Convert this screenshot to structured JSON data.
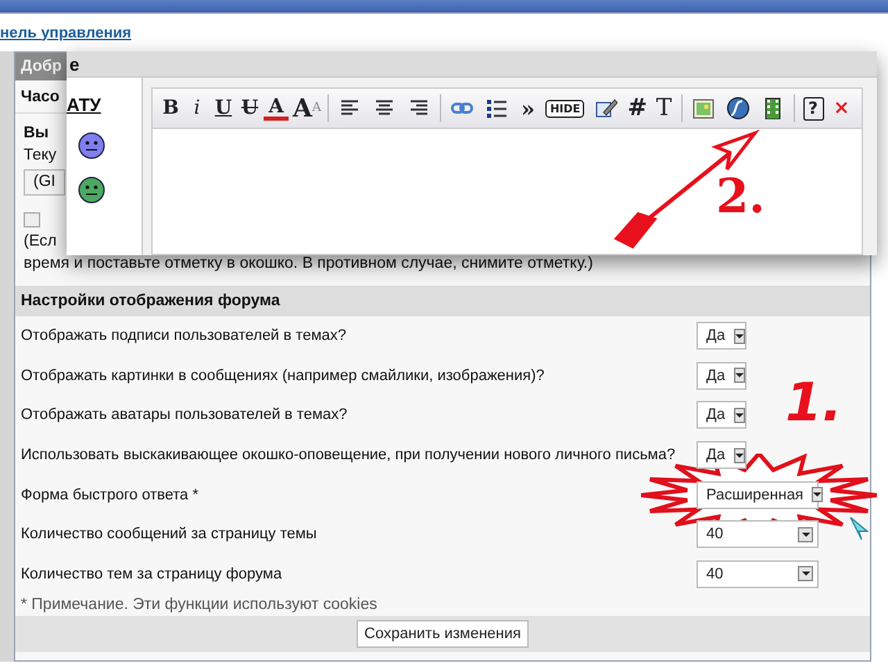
{
  "nav_link": "нель управления",
  "panel": {
    "title": "Добр",
    "subheader": "Часо",
    "heading": "Вы",
    "label": "Теку",
    "select_value": "(GI",
    "checkbox": {
      "checked": false
    },
    "text_1": "(Есл",
    "text_2": "время и поставьте отметку в окошко. В противном случае, снимите отметку.)"
  },
  "display_settings": {
    "heading": "Настройки отображения форума",
    "rows": [
      {
        "label": "Отображать подписи пользователей в темах?",
        "value": "Да",
        "kind": "short",
        "highlighted": false
      },
      {
        "label": "Отображать картинки в сообщениях (например смайлики, изображения)?",
        "value": "Да",
        "kind": "short",
        "highlighted": false
      },
      {
        "label": "Отображать аватары пользователей в темах?",
        "value": "Да",
        "kind": "short",
        "highlighted": false
      },
      {
        "label": "Использовать выскакивающее окошко-оповещение, при получении нового личного письма?",
        "value": "Да",
        "kind": "short",
        "highlighted": false
      },
      {
        "label": "Форма быстрого ответа *",
        "value": "Расширенная",
        "kind": "long",
        "highlighted": true
      },
      {
        "label": "Количество сообщений за страницу темы",
        "value": "40",
        "kind": "long",
        "highlighted": false
      },
      {
        "label": "Количество тем за страницу форума",
        "value": "40",
        "kind": "long",
        "highlighted": false
      }
    ],
    "footnote": "* Примечание. Эти функции используют cookies",
    "save_button": "Сохранить изменения"
  },
  "popup": {
    "title": "е",
    "sidebar_heading": "АТУ",
    "annotation": "2.",
    "toolbar": [
      {
        "kind": "bold",
        "label": "B"
      },
      {
        "kind": "italic",
        "label": "i"
      },
      {
        "kind": "underline",
        "label": "U"
      },
      {
        "kind": "strike",
        "label": "U"
      },
      {
        "kind": "color",
        "label": "A"
      },
      {
        "kind": "size",
        "label": "A",
        "sup": "A"
      },
      {
        "kind": "sep"
      },
      {
        "kind": "align-left"
      },
      {
        "kind": "align-center"
      },
      {
        "kind": "align-right"
      },
      {
        "kind": "sep"
      },
      {
        "kind": "link"
      },
      {
        "kind": "list"
      },
      {
        "kind": "quote",
        "label": "»"
      },
      {
        "kind": "hide",
        "label": "HIDE"
      },
      {
        "kind": "edit"
      },
      {
        "kind": "code",
        "label": "#"
      },
      {
        "kind": "font",
        "label": "T"
      },
      {
        "kind": "sep"
      },
      {
        "kind": "image"
      },
      {
        "kind": "flash"
      },
      {
        "kind": "video"
      },
      {
        "kind": "sep"
      },
      {
        "kind": "help",
        "label": "?"
      },
      {
        "kind": "close",
        "label": "×"
      }
    ]
  },
  "annotation": "1."
}
